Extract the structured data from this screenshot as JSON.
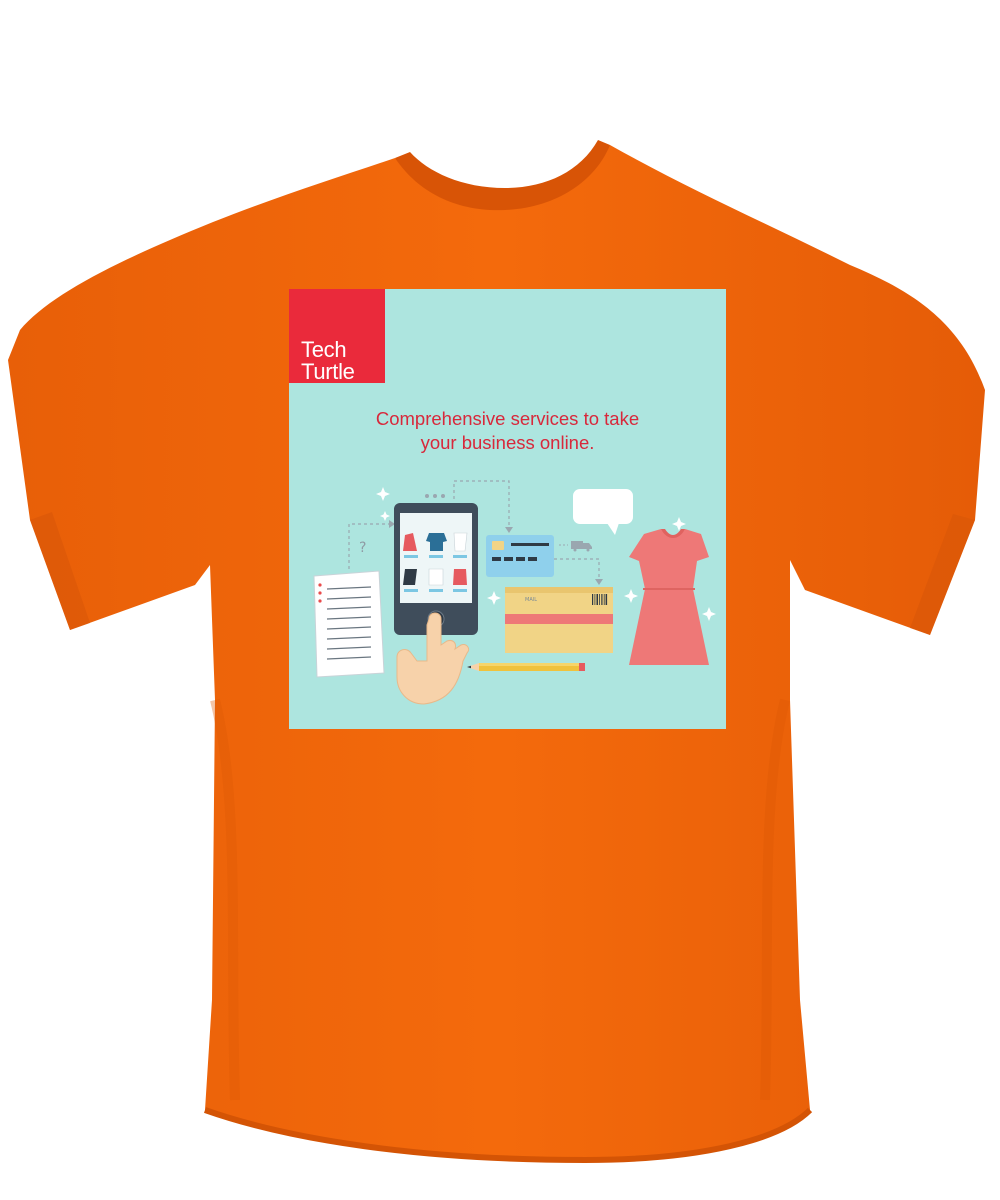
{
  "brand": {
    "line1": "Tech",
    "line2": "Turtle",
    "color": "#ea2a3b"
  },
  "headline": {
    "line1": "Comprehensive services to take",
    "line2": "your business online.",
    "color": "#d8283b"
  },
  "colors": {
    "shirt": "#f2650a",
    "print_background": "#ade5df",
    "dress": "#ee7877",
    "tablet": "#3f4d5b",
    "card": "#8fd0ec",
    "box": "#f1d486"
  },
  "illustration": {
    "box_label": "MAIL"
  }
}
